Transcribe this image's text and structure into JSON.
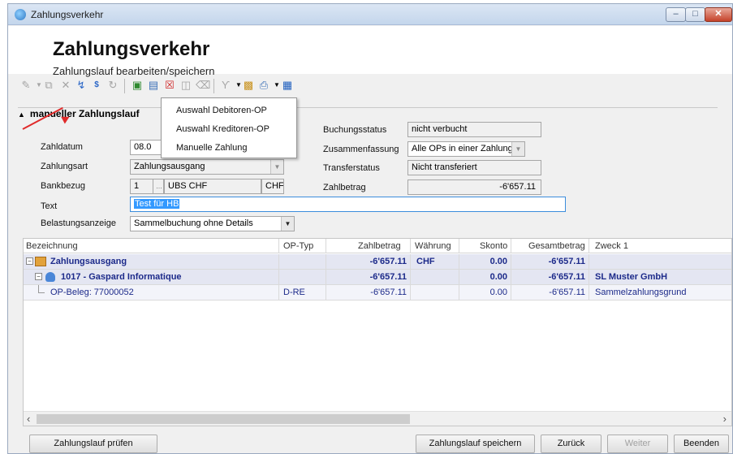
{
  "window": {
    "title": "Zahlungsverkehr"
  },
  "header": {
    "title": "Zahlungsverkehr",
    "subtitle": "Zahlungslauf bearbeiten/speichern"
  },
  "toolbar": {
    "icons": [
      "wand-icon",
      "copy-icon",
      "delete-icon",
      "lightning-icon",
      "sfr-icon",
      "refresh-icon",
      "add-document-icon",
      "edit-document-icon",
      "remove-document-icon",
      "preview-icon",
      "eraser-icon",
      "filter-icon",
      "export-icon",
      "print-icon",
      "book-icon"
    ]
  },
  "group": {
    "label": "manueller Zahlungslauf"
  },
  "dropdown_menu": {
    "items": [
      "Auswahl Debitoren-OP",
      "Auswahl Kreditoren-OP",
      "Manuelle Zahlung"
    ]
  },
  "form": {
    "zahldatum": {
      "label": "Zahldatum",
      "value": "08.0"
    },
    "zahlungsart": {
      "label": "Zahlungsart",
      "value": "Zahlungsausgang"
    },
    "bankbezug": {
      "label": "Bankbezug",
      "number": "1",
      "name": "UBS CHF",
      "currency": "CHF"
    },
    "text": {
      "label": "Text",
      "value": "Test für HB"
    },
    "belastungsanzeige": {
      "label": "Belastungsanzeige",
      "value": "Sammelbuchung ohne Details"
    },
    "buchungsstatus": {
      "label": "Buchungsstatus",
      "value": "nicht verbucht"
    },
    "zusammenfassung": {
      "label": "Zusammenfassung",
      "value": "Alle OPs in einer Zahlung"
    },
    "transferstatus": {
      "label": "Transferstatus",
      "value": "Nicht transferiert"
    },
    "zahlbetrag": {
      "label": "Zahlbetrag",
      "value": "-6'657.11"
    }
  },
  "grid": {
    "columns": [
      "Bezeichnung",
      "OP-Typ",
      "Zahlbetrag",
      "Währung",
      "Skonto",
      "Gesamtbetrag",
      "Zweck 1"
    ],
    "rows": [
      {
        "bezeichnung": "Zahlungsausgang",
        "op_typ": "",
        "zahlbetrag": "-6'657.11",
        "waehrung": "CHF",
        "skonto": "0.00",
        "gesamtbetrag": "-6'657.11",
        "zweck": ""
      },
      {
        "bezeichnung": "1017 - Gaspard Informatique",
        "op_typ": "",
        "zahlbetrag": "-6'657.11",
        "waehrung": "",
        "skonto": "0.00",
        "gesamtbetrag": "-6'657.11",
        "zweck": "SL Muster GmbH"
      },
      {
        "bezeichnung": "OP-Beleg: 77000052",
        "op_typ": "D-RE",
        "zahlbetrag": "-6'657.11",
        "waehrung": "",
        "skonto": "0.00",
        "gesamtbetrag": "-6'657.11",
        "zweck": "Sammelzahlungsgrund"
      }
    ]
  },
  "buttons": {
    "pruefen": "Zahlungslauf prüfen",
    "speichern": "Zahlungslauf speichern",
    "zurueck": "Zurück",
    "weiter": "Weiter",
    "beenden": "Beenden"
  },
  "colors": {
    "accent": "#1c2a8a",
    "selection": "#3399ff",
    "annotation_arrow": "#e02a2a"
  }
}
